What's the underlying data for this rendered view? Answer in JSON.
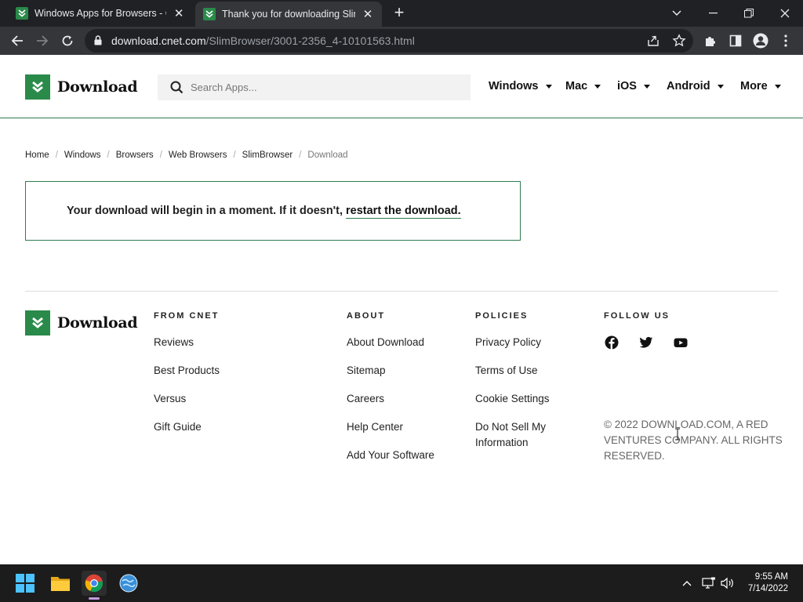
{
  "browser": {
    "tabs": [
      {
        "title": "Windows Apps for Browsers - CNET Download",
        "active": false
      },
      {
        "title": "Thank you for downloading SlimBrowser",
        "active": true
      }
    ],
    "url_host": "download.cnet.com",
    "url_path": "/SlimBrowser/3001-2356_4-10101563.html"
  },
  "header": {
    "logo_text": "Download",
    "search_placeholder": "Search Apps...",
    "nav": [
      "Windows",
      "Mac",
      "iOS",
      "Android",
      "More"
    ]
  },
  "breadcrumb": [
    "Home",
    "Windows",
    "Browsers",
    "Web Browsers",
    "SlimBrowser",
    "Download"
  ],
  "message": {
    "text": "Your download will begin in a moment. If it doesn't, ",
    "link": "restart the download."
  },
  "footer": {
    "logo_text": "Download",
    "columns": [
      {
        "heading": "FROM CNET",
        "links": [
          "Reviews",
          "Best Products",
          "Versus",
          "Gift Guide"
        ]
      },
      {
        "heading": "ABOUT",
        "links": [
          "About Download",
          "Sitemap",
          "Careers",
          "Help Center",
          "Add Your Software"
        ]
      },
      {
        "heading": "POLICIES",
        "links": [
          "Privacy Policy",
          "Terms of Use",
          "Cookie Settings",
          "Do Not Sell My Information"
        ]
      },
      {
        "heading": "FOLLOW US",
        "links": []
      }
    ],
    "social": [
      "facebook-icon",
      "twitter-icon",
      "youtube-icon"
    ],
    "copyright": "© 2022 DOWNLOAD.COM, A RED VENTURES COMPANY. ALL RIGHTS RESERVED."
  },
  "taskbar": {
    "time": "9:55 AM",
    "date": "7/14/2022"
  },
  "colors": {
    "brand_green": "#2a8a4a",
    "chrome_dark": "#202124",
    "chrome_toolbar": "#35363a"
  }
}
